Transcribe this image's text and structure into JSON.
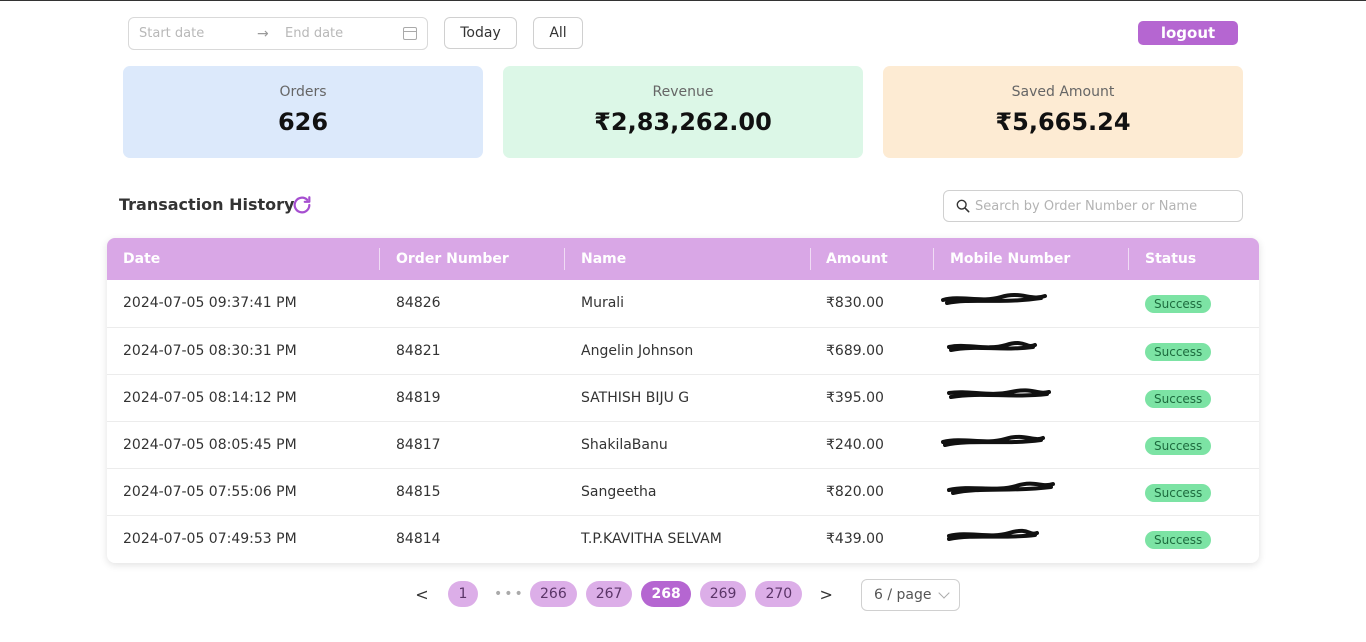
{
  "toolbar": {
    "start_placeholder": "Start date",
    "end_placeholder": "End date",
    "today_label": "Today",
    "all_label": "All",
    "logout_label": "logout"
  },
  "stats": {
    "orders": {
      "label": "Orders",
      "value": "626"
    },
    "revenue": {
      "label": "Revenue",
      "value": "₹2,83,262.00"
    },
    "saved": {
      "label": "Saved Amount",
      "value": "₹5,665.24"
    }
  },
  "history": {
    "title": "Transaction History",
    "search_placeholder": "Search by Order Number or Name"
  },
  "table": {
    "headers": {
      "date": "Date",
      "order": "Order Number",
      "name": "Name",
      "amount": "Amount",
      "mobile": "Mobile Number",
      "status": "Status"
    },
    "rows": [
      {
        "date": "2024-07-05 09:37:41 PM",
        "order": "84826",
        "name": "Murali",
        "amount": "₹830.00",
        "status": "Success"
      },
      {
        "date": "2024-07-05 08:30:31 PM",
        "order": "84821",
        "name": "Angelin Johnson",
        "amount": "₹689.00",
        "status": "Success"
      },
      {
        "date": "2024-07-05 08:14:12 PM",
        "order": "84819",
        "name": "SATHISH BIJU G",
        "amount": "₹395.00",
        "status": "Success"
      },
      {
        "date": "2024-07-05 08:05:45 PM",
        "order": "84817",
        "name": "ShakilaBanu",
        "amount": "₹240.00",
        "status": "Success"
      },
      {
        "date": "2024-07-05 07:55:06 PM",
        "order": "84815",
        "name": "Sangeetha",
        "amount": "₹820.00",
        "status": "Success"
      },
      {
        "date": "2024-07-05 07:49:53 PM",
        "order": "84814",
        "name": "T.P.KAVITHA SELVAM",
        "amount": "₹439.00",
        "status": "Success"
      }
    ]
  },
  "pagination": {
    "prev": "<",
    "next": ">",
    "dots": "•••",
    "pages": [
      "1",
      "266",
      "267",
      "268",
      "269",
      "270"
    ],
    "current": "268",
    "page_size": "6 / page"
  },
  "colors": {
    "accent": "#b566d1",
    "header_bg": "#d9a7e6",
    "orders_card": "#dce9fb",
    "revenue_card": "#dcf7e7",
    "saved_card": "#fdebd3",
    "success_badge": "#7ce3a4"
  }
}
